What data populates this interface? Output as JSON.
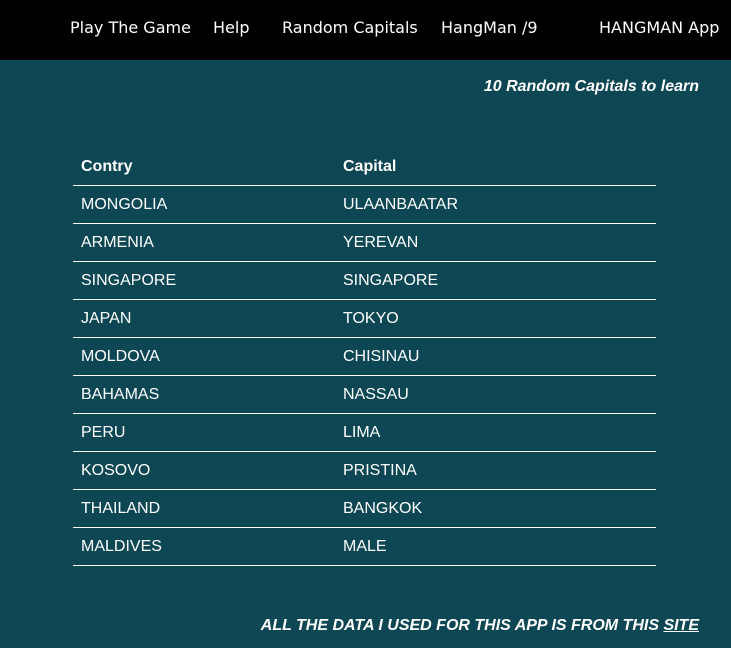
{
  "nav": {
    "play": "Play The Game",
    "help": "Help",
    "random": "Random Capitals",
    "hangman": "HangMan /9",
    "brand": "HANGMAN App"
  },
  "subtitle": "10 Random Capitals to learn",
  "table": {
    "headers": [
      "Contry",
      "Capital"
    ],
    "rows": [
      [
        "MONGOLIA",
        "ULAANBAATAR"
      ],
      [
        "ARMENIA",
        "YEREVAN"
      ],
      [
        "SINGAPORE",
        "SINGAPORE"
      ],
      [
        "JAPAN",
        "TOKYO"
      ],
      [
        "MOLDOVA",
        "CHISINAU"
      ],
      [
        "BAHAMAS",
        "NASSAU"
      ],
      [
        "PERU",
        "LIMA"
      ],
      [
        "KOSOVO",
        "PRISTINA"
      ],
      [
        "THAILAND",
        "BANGKOK"
      ],
      [
        "MALDIVES",
        "MALE"
      ]
    ]
  },
  "footer": {
    "text": "ALL THE DATA I USED FOR THIS APP IS FROM THIS ",
    "link": "SITE"
  },
  "colors": {
    "background": "#0d4754",
    "navbar": "#000000",
    "text": "#ffffff"
  }
}
